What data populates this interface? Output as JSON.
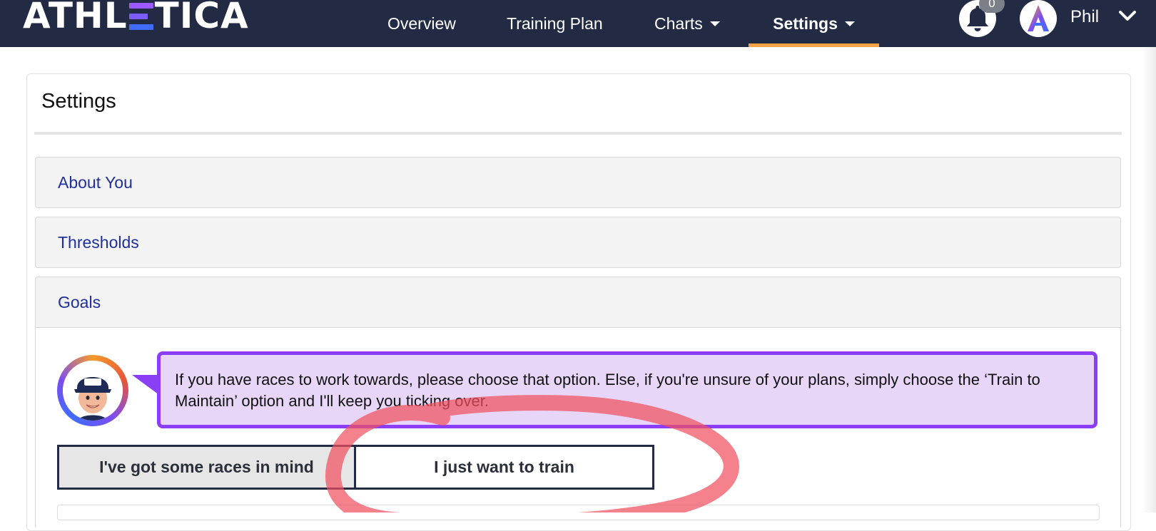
{
  "header": {
    "logo_text_pre": "ATHL",
    "logo_text_post": "TICA",
    "nav": {
      "overview": "Overview",
      "training_plan": "Training Plan",
      "charts": "Charts",
      "settings": "Settings"
    },
    "notification_count": "0",
    "user_name": "Phil",
    "active_accent": "#f5a343",
    "bar_color": "#222a44"
  },
  "card": {
    "title": "Settings",
    "sections": {
      "about": "About You",
      "thresholds": "Thresholds",
      "goals": "Goals"
    }
  },
  "goals": {
    "message": "If you have races to work towards, please choose that option. Else, if you're unsure of your plans, simply choose the ‘Train to Maintain’ option and I'll keep you ticking over.",
    "option_races": "I've got some races in mind",
    "option_train": "I just want to train",
    "bubble_color": "#e7d6f7",
    "bubble_border": "#8a3ef5"
  },
  "icons": {
    "bell": "bell-icon",
    "brand": "athletica-a-icon",
    "chevron": "chevron-down-icon"
  }
}
